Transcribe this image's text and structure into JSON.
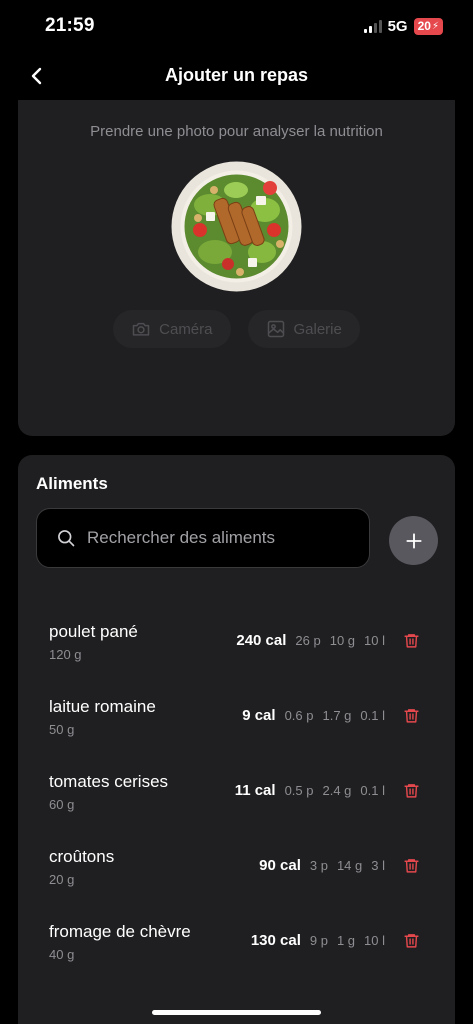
{
  "status_bar": {
    "time": "21:59",
    "network": "5G",
    "battery": "20"
  },
  "nav": {
    "title": "Ajouter un repas",
    "back_icon": "chevron-left-icon"
  },
  "photo": {
    "hint": "Prendre une photo pour analyser la nutrition",
    "camera_label": "Caméra",
    "gallery_label": "Galerie"
  },
  "foods": {
    "title": "Aliments",
    "search_placeholder": "Rechercher des aliments",
    "items": [
      {
        "name": "poulet pané",
        "qty": "120 g",
        "cal": "240 cal",
        "protein": "26 p",
        "carbs": "10 g",
        "lipids": "10 l"
      },
      {
        "name": "laitue romaine",
        "qty": "50 g",
        "cal": "9 cal",
        "protein": "0.6 p",
        "carbs": "1.7 g",
        "lipids": "0.1 l"
      },
      {
        "name": "tomates cerises",
        "qty": "60 g",
        "cal": "11 cal",
        "protein": "0.5 p",
        "carbs": "2.4 g",
        "lipids": "0.1 l"
      },
      {
        "name": "croûtons",
        "qty": "20 g",
        "cal": "90 cal",
        "protein": "3 p",
        "carbs": "14 g",
        "lipids": "3 l"
      },
      {
        "name": "fromage de chèvre",
        "qty": "40 g",
        "cal": "130 cal",
        "protein": "9 p",
        "carbs": "1 g",
        "lipids": "10 l"
      }
    ]
  },
  "colors": {
    "card": "#1f1f21",
    "delete": "#e5484d",
    "muted": "#8e8e93"
  }
}
